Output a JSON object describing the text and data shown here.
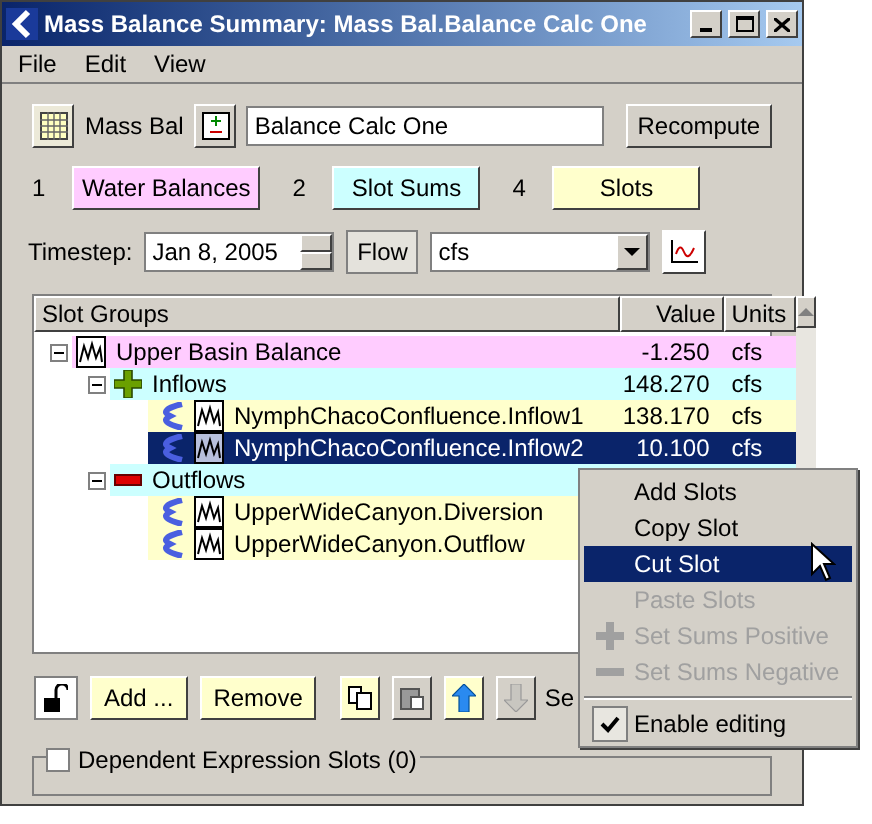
{
  "window": {
    "title": "Mass Balance Summary: Mass Bal.Balance Calc One"
  },
  "menu_bar": [
    "File",
    "Edit",
    "View"
  ],
  "toolbar": {
    "label": "Mass Bal",
    "name_field": "Balance Calc One",
    "recompute_button": "Recompute"
  },
  "tabs": [
    {
      "count": "1",
      "label": "Water Balances",
      "color": "#ffccff"
    },
    {
      "count": "2",
      "label": "Slot Sums",
      "color": "#ccffff"
    },
    {
      "count": "4",
      "label": "Slots",
      "color": "#ffffcc"
    }
  ],
  "timestep": {
    "label": "Timestep:",
    "value": "Jan 8, 2005",
    "flow_button": "Flow",
    "units_select": "cfs"
  },
  "tree": {
    "columns": [
      "Slot Groups",
      "Value",
      "Units"
    ],
    "rows": [
      {
        "kind": "balance",
        "label": "Upper Basin Balance",
        "value": "-1.250",
        "units": "cfs",
        "selected": false,
        "expanded": true,
        "children": [
          {
            "kind": "inflows",
            "label": "Inflows",
            "value": "148.270",
            "units": "cfs",
            "selected": false,
            "expanded": true,
            "children": [
              {
                "kind": "slot",
                "label": "NymphChacoConfluence.Inflow1",
                "value": "138.170",
                "units": "cfs",
                "selected": false
              },
              {
                "kind": "slot",
                "label": "NymphChacoConfluence.Inflow2",
                "value": "10.100",
                "units": "cfs",
                "selected": true
              }
            ]
          },
          {
            "kind": "outflows",
            "label": "Outflows",
            "selected": false,
            "expanded": true,
            "children": [
              {
                "kind": "slot",
                "label": "UpperWideCanyon.Diversion",
                "selected": false
              },
              {
                "kind": "slot",
                "label": "UpperWideCanyon.Outflow",
                "selected": false
              }
            ]
          }
        ]
      }
    ]
  },
  "bottom_bar": {
    "add_button": "Add ...",
    "remove_button": "Remove",
    "partial_label": "Se"
  },
  "dependent": {
    "label": "Dependent Expression Slots (0)",
    "checked": false
  },
  "context_menu": [
    {
      "kind": "item",
      "label": "Add Slots",
      "disabled": false,
      "selected": false
    },
    {
      "kind": "item",
      "label": "Copy Slot",
      "disabled": false,
      "selected": false
    },
    {
      "kind": "item",
      "label": "Cut Slot",
      "disabled": false,
      "selected": true
    },
    {
      "kind": "item",
      "label": "Paste Slots",
      "disabled": true,
      "selected": false
    },
    {
      "kind": "plus",
      "label": "Set Sums Positive",
      "disabled": true,
      "selected": false
    },
    {
      "kind": "minus",
      "label": "Set Sums Negative",
      "disabled": true,
      "selected": false
    },
    {
      "kind": "separator"
    },
    {
      "kind": "check",
      "label": "Enable editing",
      "disabled": false,
      "selected": false,
      "checked": true
    }
  ]
}
